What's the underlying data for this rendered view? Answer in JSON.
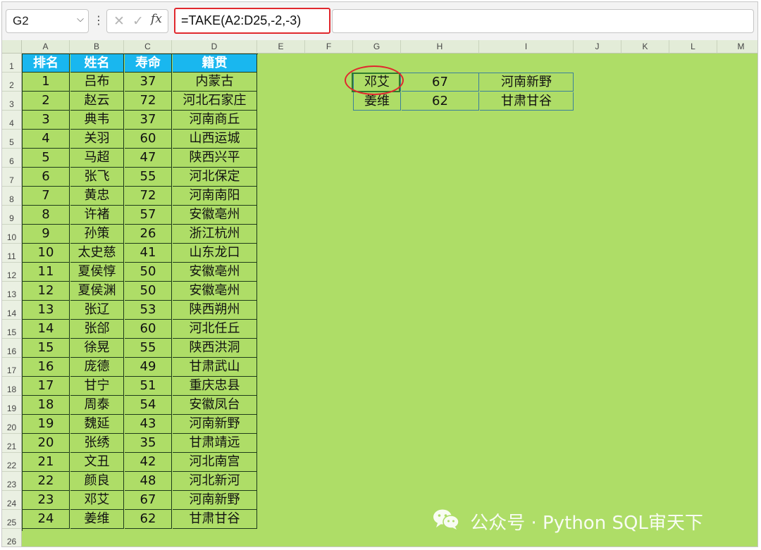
{
  "formula_bar": {
    "name_box": "G2",
    "name_box_dropdown": "⌵",
    "more_icon": "⋮",
    "cancel_icon": "✕",
    "enter_icon": "✓",
    "fx_label": "fx",
    "formula": "=TAKE(A2:D25,-2,-3)"
  },
  "columns": [
    "A",
    "B",
    "C",
    "D",
    "E",
    "F",
    "G",
    "H",
    "I",
    "J",
    "K",
    "L",
    "M"
  ],
  "rows": [
    "1",
    "2",
    "3",
    "4",
    "5",
    "6",
    "7",
    "8",
    "9",
    "10",
    "11",
    "12",
    "13",
    "14",
    "15",
    "16",
    "17",
    "18",
    "19",
    "20",
    "21",
    "22",
    "23",
    "24",
    "25",
    "26"
  ],
  "table": {
    "headers": [
      "排名",
      "姓名",
      "寿命",
      "籍贯"
    ],
    "rows": [
      [
        "1",
        "吕布",
        "37",
        "内蒙古"
      ],
      [
        "2",
        "赵云",
        "72",
        "河北石家庄"
      ],
      [
        "3",
        "典韦",
        "37",
        "河南商丘"
      ],
      [
        "4",
        "关羽",
        "60",
        "山西运城"
      ],
      [
        "5",
        "马超",
        "47",
        "陕西兴平"
      ],
      [
        "6",
        "张飞",
        "55",
        "河北保定"
      ],
      [
        "7",
        "黄忠",
        "72",
        "河南南阳"
      ],
      [
        "8",
        "许褚",
        "57",
        "安徽亳州"
      ],
      [
        "9",
        "孙策",
        "26",
        "浙江杭州"
      ],
      [
        "10",
        "太史慈",
        "41",
        "山东龙口"
      ],
      [
        "11",
        "夏侯惇",
        "50",
        "安徽亳州"
      ],
      [
        "12",
        "夏侯渊",
        "50",
        "安徽亳州"
      ],
      [
        "13",
        "张辽",
        "53",
        "陕西朔州"
      ],
      [
        "14",
        "张郃",
        "60",
        "河北任丘"
      ],
      [
        "15",
        "徐晃",
        "55",
        "陕西洪洞"
      ],
      [
        "16",
        "庞德",
        "49",
        "甘肃武山"
      ],
      [
        "17",
        "甘宁",
        "51",
        "重庆忠县"
      ],
      [
        "18",
        "周泰",
        "54",
        "安徽凤台"
      ],
      [
        "19",
        "魏延",
        "43",
        "河南新野"
      ],
      [
        "20",
        "张绣",
        "35",
        "甘肃靖远"
      ],
      [
        "21",
        "文丑",
        "42",
        "河北南宫"
      ],
      [
        "22",
        "颜良",
        "48",
        "河北新河"
      ],
      [
        "23",
        "邓艾",
        "67",
        "河南新野"
      ],
      [
        "24",
        "姜维",
        "62",
        "甘肃甘谷"
      ]
    ]
  },
  "result": {
    "rows": [
      [
        "邓艾",
        "67",
        "河南新野"
      ],
      [
        "姜维",
        "62",
        "甘肃甘谷"
      ]
    ]
  },
  "watermark": "公众号 · Python SQL审天下",
  "colors": {
    "sheet_bg": "#aedd67",
    "header_fill": "#19b7ef",
    "highlight_red": "#e0282e"
  }
}
